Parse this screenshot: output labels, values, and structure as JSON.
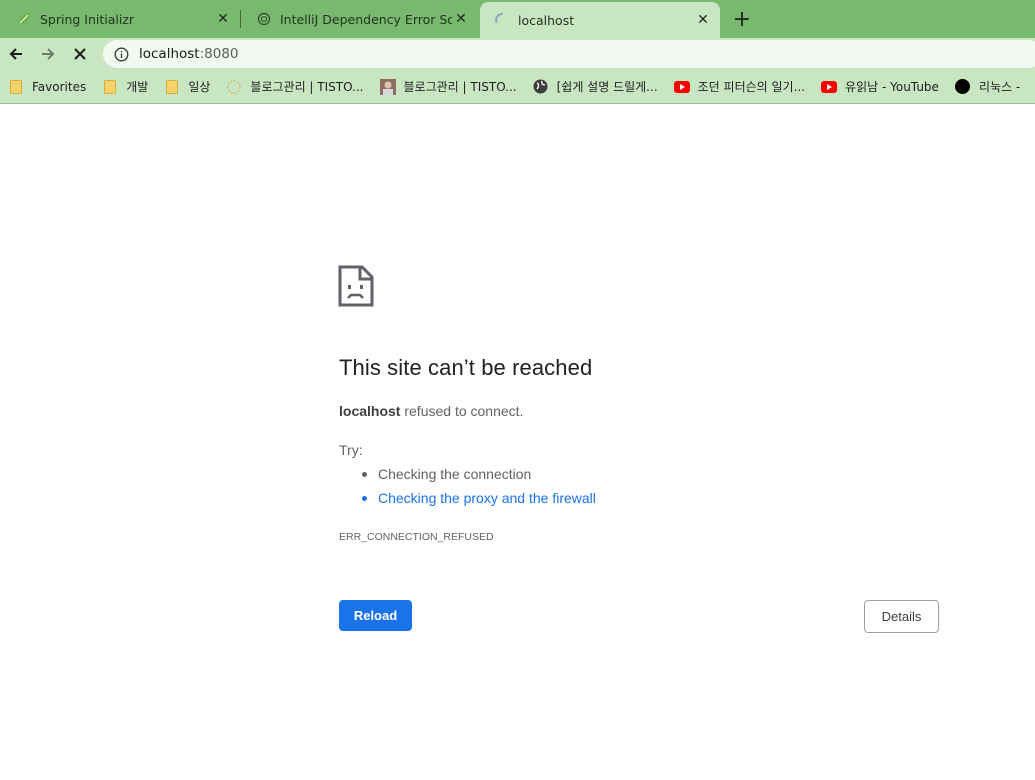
{
  "colors": {
    "tabstrip": "#79b86f",
    "toolbar": "#c8e6c1",
    "link": "#1a73e8",
    "reload_button": "#1a73e8"
  },
  "tabs": [
    {
      "title": "Spring Initializr",
      "icon": "spring-leaf-icon"
    },
    {
      "title": "IntelliJ Dependency Error Solutio",
      "icon": "chatgpt-icon"
    },
    {
      "title": "localhost",
      "icon": "loading-spinner-icon",
      "active": true
    }
  ],
  "toolbar": {
    "url_host": "localhost",
    "url_port": ":8080"
  },
  "bookmarks": [
    {
      "label": "Favorites",
      "icon": "folder-icon"
    },
    {
      "label": "개발",
      "icon": "folder-icon"
    },
    {
      "label": "일상",
      "icon": "folder-icon"
    },
    {
      "label": "블로그관리 | TISTO...",
      "icon": "tistory-icon"
    },
    {
      "label": "블로그관리 | TISTO...",
      "icon": "avatar-icon"
    },
    {
      "label": "[쉽게 설명 드릴게...",
      "icon": "globe-icon"
    },
    {
      "label": "조던 피터슨의 일기...",
      "icon": "youtube-icon"
    },
    {
      "label": "유읽남 - YouTube",
      "icon": "youtube-icon"
    },
    {
      "label": "리눅스 -",
      "icon": "black-circle-icon"
    }
  ],
  "error": {
    "title": "This site can’t be reached",
    "host": "localhost",
    "desc_rest": " refused to connect.",
    "try_label": "Try:",
    "suggestions": [
      "Checking the connection",
      "Checking the proxy and the firewall"
    ],
    "code": "ERR_CONNECTION_REFUSED",
    "reload_label": "Reload",
    "details_label": "Details"
  }
}
